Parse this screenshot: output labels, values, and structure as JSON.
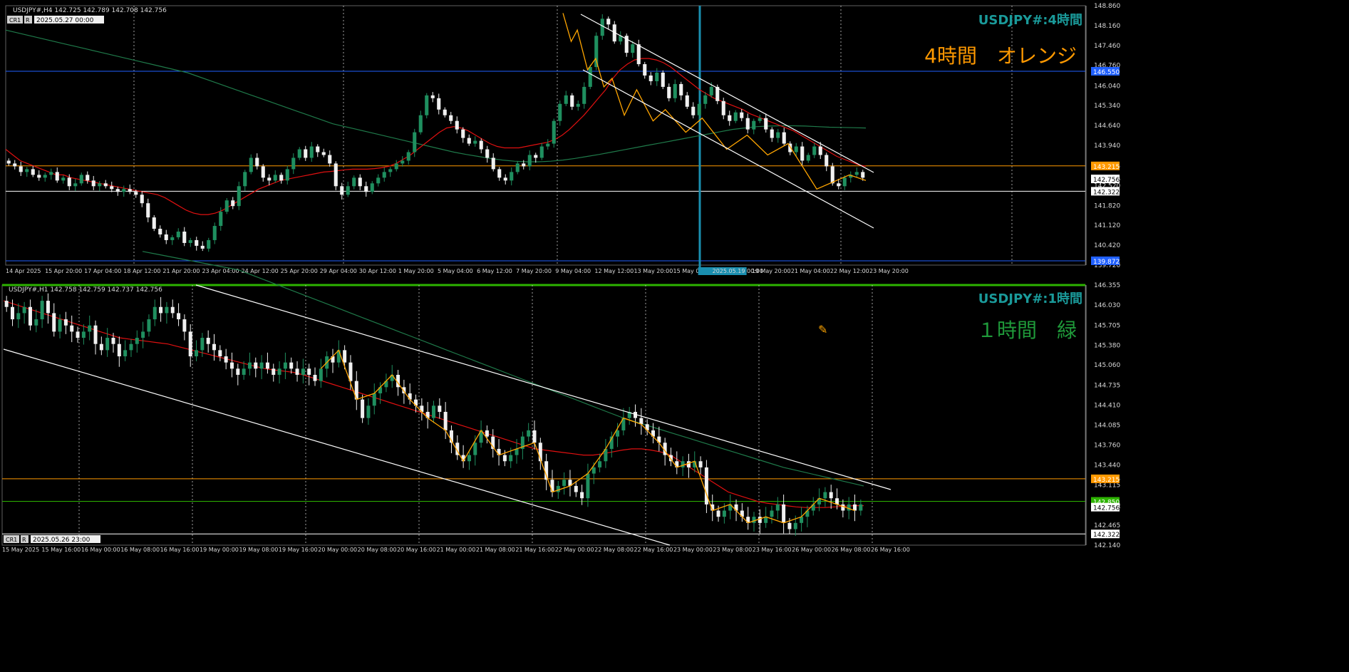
{
  "colors": {
    "background": "#000000",
    "grid": "#c8c8c8",
    "bull_candle": "#1f8f5f",
    "bear_candle": "#f0f0f0",
    "ma_red": "#e01010",
    "ma_green": "#1f7a4a",
    "zigzag": "#ffa500",
    "channel": "#ffffff",
    "level_orange": "#ff9900",
    "level_blue": "#2060ff",
    "level_white": "#ffffff",
    "level_green": "#2db300",
    "vline_cyan": "#1a8fb0",
    "title_teal": "#1a9a9a",
    "note_orange": "#ff9900",
    "note_green": "#1f9a3a",
    "axis_text": "#d8d8d8"
  },
  "chart_data": [
    {
      "type": "candlestick",
      "symbol_header": "USDJPY#,H4  142.725 142.789 142.708 142.756",
      "crosshair_box": {
        "btn1": "CR1",
        "btn2": "R",
        "datetime": "2025.05.27 00:00"
      },
      "title": "USDJPY#:4時間",
      "note": "4時間　オレンジ",
      "ylim": [
        139.72,
        148.86
      ],
      "y_ticks": [
        "148.860",
        "148.160",
        "147.460",
        "146.760",
        "146.040",
        "145.340",
        "144.640",
        "143.940",
        "143.215",
        "142.756",
        "142.520",
        "142.322",
        "141.820",
        "141.120",
        "140.420",
        "139.872",
        "139.720"
      ],
      "x_ticks": [
        "14 Apr 2025",
        "15 Apr 20:00",
        "17 Apr 04:00",
        "18 Apr 12:00",
        "21 Apr 20:00",
        "23 Apr 04:00",
        "24 Apr 12:00",
        "25 Apr 20:00",
        "29 Apr 04:00",
        "30 Apr 12:00",
        "1 May 20:00",
        "5 May 04:00",
        "6 May 12:00",
        "7 May 20:00",
        "9 May 04:00",
        "12 May 12:00",
        "13 May 20:00",
        "15 May 04:00",
        "2025.05.19 00:00",
        "19 May 20:00",
        "21 May 04:00",
        "22 May 12:00",
        "23 May 20:00"
      ],
      "price_labels": [
        {
          "value": 146.55,
          "text": "146.550",
          "color": "level_blue"
        },
        {
          "value": 143.215,
          "text": "143.215",
          "color": "level_orange"
        },
        {
          "value": 142.756,
          "text": "142.756",
          "color": "level_white"
        },
        {
          "value": 142.322,
          "text": "142.322",
          "color": "level_white"
        },
        {
          "value": 139.872,
          "text": "139.872",
          "color": "level_blue"
        }
      ],
      "closes": [
        143.3,
        143.2,
        143.0,
        143.1,
        142.9,
        142.8,
        142.9,
        143.0,
        142.7,
        142.8,
        142.5,
        142.6,
        142.9,
        142.7,
        142.5,
        142.6,
        142.5,
        142.4,
        142.3,
        142.4,
        142.3,
        142.2,
        141.9,
        141.4,
        141.0,
        140.8,
        140.6,
        140.7,
        140.9,
        140.5,
        140.6,
        140.4,
        140.3,
        140.6,
        141.1,
        141.6,
        142.0,
        141.8,
        142.5,
        143.0,
        143.5,
        143.2,
        142.8,
        142.7,
        142.9,
        142.7,
        143.1,
        143.5,
        143.8,
        143.5,
        143.9,
        143.7,
        143.6,
        143.3,
        142.5,
        142.2,
        142.5,
        142.8,
        142.5,
        142.3,
        142.6,
        142.8,
        143.0,
        143.1,
        143.3,
        143.4,
        143.7,
        144.4,
        145.0,
        145.7,
        145.6,
        145.2,
        145.0,
        144.8,
        144.5,
        144.2,
        144.0,
        144.1,
        143.8,
        143.5,
        143.1,
        142.8,
        142.7,
        143.0,
        143.3,
        143.2,
        143.6,
        143.5,
        143.9,
        144.0,
        144.8,
        145.4,
        145.7,
        145.3,
        145.4,
        146.0,
        146.7,
        147.8,
        148.4,
        148.2,
        147.6,
        147.8,
        147.2,
        147.5,
        146.8,
        146.4,
        146.2,
        146.5,
        146.0,
        145.6,
        146.1,
        145.7,
        145.3,
        145.0,
        145.4,
        145.7,
        146.0,
        145.5,
        145.0,
        144.8,
        145.1,
        144.9,
        144.5,
        144.8,
        144.9,
        144.5,
        144.2,
        144.4,
        144.0,
        143.7,
        143.9,
        143.4,
        143.6,
        143.9,
        143.6,
        143.2,
        142.6,
        142.5,
        142.8,
        142.9,
        143.0,
        142.8
      ],
      "ma_red": [
        143.8,
        143.6,
        143.4,
        143.3,
        143.2,
        143.1,
        143.0,
        142.9,
        142.9,
        142.8,
        142.75,
        142.7,
        142.65,
        142.6,
        142.55,
        142.5,
        142.45,
        142.4,
        142.35,
        142.3,
        142.25,
        142.2,
        142.1,
        141.95,
        141.8,
        141.65,
        141.55,
        141.5,
        141.5,
        141.55,
        141.65,
        141.8,
        141.95,
        142.1,
        142.25,
        142.4,
        142.5,
        142.6,
        142.7,
        142.75,
        142.8,
        142.85,
        142.9,
        142.95,
        143.0,
        143.02,
        143.05,
        143.08,
        143.1,
        143.1,
        143.1,
        143.12,
        143.15,
        143.2,
        143.3,
        143.45,
        143.6,
        143.8,
        144.0,
        144.2,
        144.4,
        144.55,
        144.6,
        144.55,
        144.45,
        144.3,
        144.15,
        144.0,
        143.9,
        143.85,
        143.85,
        143.85,
        143.9,
        143.95,
        144.0,
        144.05,
        144.15,
        144.3,
        144.5,
        144.75,
        145.0,
        145.3,
        145.6,
        145.9,
        146.3,
        146.6,
        146.8,
        146.95,
        147.0,
        147.0,
        146.95,
        146.85,
        146.7,
        146.5,
        146.3,
        146.1,
        145.9,
        145.75,
        145.6,
        145.5,
        145.4,
        145.3,
        145.2,
        145.05,
        144.95,
        144.85,
        144.75,
        144.65,
        144.55,
        144.45,
        144.3,
        144.15,
        144.0,
        143.85,
        143.7,
        143.55,
        143.45,
        143.35,
        143.25,
        143.2
      ],
      "ma_green": [
        148.0,
        147.9,
        147.8,
        147.7,
        147.6,
        147.5,
        147.4,
        147.3,
        147.2,
        147.1,
        147.0,
        146.9,
        146.8,
        146.7,
        146.6,
        146.5,
        146.35,
        146.2,
        146.05,
        145.9,
        145.75,
        145.6,
        145.45,
        145.3,
        145.15,
        145.0,
        144.85,
        144.7,
        144.6,
        144.5,
        144.4,
        144.3,
        144.2,
        144.1,
        144.0,
        143.9,
        143.8,
        143.7,
        143.62,
        143.55,
        143.48,
        143.42,
        143.38,
        143.36,
        143.36,
        143.38,
        143.42,
        143.48,
        143.55,
        143.62,
        143.7,
        143.78,
        143.86,
        143.94,
        144.02,
        144.1,
        144.18,
        144.26,
        144.34,
        144.42,
        144.5,
        144.55,
        144.6,
        144.62,
        144.63,
        144.63,
        144.62,
        144.6,
        144.58,
        144.57,
        144.56,
        144.55
      ],
      "zigzag": [
        [
          148.6,
          0
        ],
        [
          147.6,
          0.02
        ],
        [
          148.0,
          0.035
        ],
        [
          146.6,
          0.06
        ],
        [
          147.0,
          0.08
        ],
        [
          146.0,
          0.1
        ],
        [
          146.3,
          0.12
        ],
        [
          145.0,
          0.15
        ],
        [
          145.9,
          0.18
        ],
        [
          144.8,
          0.22
        ],
        [
          145.2,
          0.25
        ],
        [
          144.4,
          0.3
        ],
        [
          144.9,
          0.34
        ],
        [
          143.8,
          0.4
        ],
        [
          144.3,
          0.45
        ],
        [
          143.6,
          0.5
        ],
        [
          144.0,
          0.55
        ],
        [
          142.4,
          0.62
        ],
        [
          142.9,
          0.7
        ],
        [
          142.7,
          0.74
        ]
      ]
    },
    {
      "type": "candlestick",
      "symbol_header": "USDJPY#,H1  142.758 142.759 142.737 142.756",
      "crosshair_box": {
        "btn1": "CR1",
        "btn2": "R",
        "datetime": "2025.05.26 23:00"
      },
      "title": "USDJPY#:1時間",
      "note": "１時間　緑",
      "ylim": [
        142.14,
        146.355
      ],
      "y_ticks": [
        "146.355",
        "146.030",
        "145.705",
        "145.380",
        "145.060",
        "144.735",
        "144.410",
        "144.085",
        "143.760",
        "143.440",
        "143.215",
        "143.115",
        "142.790",
        "142.756",
        "142.465",
        "142.322",
        "142.140"
      ],
      "x_ticks": [
        "15 May 2025",
        "15 May 16:00",
        "16 May 00:00",
        "16 May 08:00",
        "16 May 16:00",
        "19 May 00:00",
        "19 May 08:00",
        "19 May 16:00",
        "20 May 00:00",
        "20 May 08:00",
        "20 May 16:00",
        "21 May 00:00",
        "21 May 08:00",
        "21 May 16:00",
        "22 May 00:00",
        "22 May 08:00",
        "22 May 16:00",
        "23 May 00:00",
        "23 May 08:00",
        "23 May 16:00",
        "26 May 00:00",
        "26 May 08:00",
        "26 May 16:00"
      ],
      "price_labels": [
        {
          "value": 143.215,
          "text": "143.215",
          "color": "level_orange"
        },
        {
          "value": 142.85,
          "text": "142.850",
          "color": "level_green"
        },
        {
          "value": 142.756,
          "text": "142.756",
          "color": "level_white"
        },
        {
          "value": 142.322,
          "text": "142.322",
          "color": "level_white"
        }
      ],
      "closes": [
        146.0,
        145.8,
        145.9,
        146.0,
        145.7,
        145.8,
        146.1,
        145.9,
        145.6,
        145.8,
        145.7,
        145.6,
        145.5,
        145.6,
        145.7,
        145.4,
        145.3,
        145.5,
        145.4,
        145.2,
        145.3,
        145.4,
        145.5,
        145.6,
        145.8,
        146.0,
        145.9,
        146.0,
        145.9,
        145.8,
        145.6,
        145.2,
        145.3,
        145.5,
        145.4,
        145.3,
        145.2,
        145.1,
        145.0,
        144.9,
        145.0,
        145.1,
        145.0,
        145.1,
        145.0,
        144.9,
        145.0,
        145.1,
        145.0,
        144.9,
        145.0,
        144.9,
        144.8,
        145.0,
        145.2,
        145.1,
        145.3,
        145.1,
        144.8,
        144.5,
        144.2,
        144.4,
        144.6,
        144.7,
        144.8,
        144.9,
        144.7,
        144.6,
        144.5,
        144.4,
        144.3,
        144.2,
        144.4,
        144.3,
        144.0,
        143.8,
        143.6,
        143.5,
        143.6,
        143.8,
        144.0,
        143.9,
        143.7,
        143.6,
        143.5,
        143.6,
        143.7,
        143.9,
        144.0,
        143.8,
        143.5,
        143.2,
        143.0,
        143.1,
        143.2,
        143.1,
        143.0,
        142.9,
        143.3,
        143.4,
        143.5,
        143.7,
        143.9,
        144.0,
        144.2,
        144.3,
        144.2,
        144.1,
        144.0,
        143.9,
        143.8,
        143.6,
        143.5,
        143.4,
        143.5,
        143.4,
        143.5,
        143.4,
        142.8,
        142.7,
        142.6,
        142.7,
        142.8,
        142.7,
        142.6,
        142.5,
        142.6,
        142.5,
        142.6,
        142.7,
        142.8,
        142.5,
        142.4,
        142.5,
        142.6,
        142.7,
        142.8,
        142.9,
        143.0,
        142.9,
        142.8,
        142.7,
        142.8,
        142.7,
        142.8
      ],
      "ma_red": [
        146.1,
        146.05,
        146.0,
        145.95,
        145.9,
        145.85,
        145.8,
        145.75,
        145.7,
        145.65,
        145.6,
        145.55,
        145.5,
        145.48,
        145.46,
        145.44,
        145.42,
        145.4,
        145.36,
        145.32,
        145.28,
        145.24,
        145.2,
        145.16,
        145.12,
        145.08,
        145.04,
        145.0,
        144.98,
        144.96,
        144.94,
        144.9,
        144.85,
        144.8,
        144.75,
        144.7,
        144.65,
        144.6,
        144.55,
        144.5,
        144.45,
        144.4,
        144.35,
        144.3,
        144.25,
        144.2,
        144.15,
        144.1,
        144.05,
        144.0,
        143.95,
        143.9,
        143.85,
        143.8,
        143.75,
        143.7,
        143.68,
        143.66,
        143.64,
        143.62,
        143.6,
        143.6,
        143.62,
        143.65,
        143.68,
        143.7,
        143.7,
        143.68,
        143.65,
        143.6,
        143.5,
        143.4,
        143.3,
        143.2,
        143.1,
        143.0,
        142.95,
        142.9,
        142.85,
        142.82,
        142.8,
        142.78,
        142.76,
        142.75,
        142.75,
        142.75,
        142.76,
        142.77,
        142.78,
        142.78
      ],
      "ma_green": [
        146.9,
        146.85,
        146.8,
        146.75,
        146.7,
        146.65,
        146.6,
        146.5,
        146.4,
        146.3,
        146.2,
        146.1,
        146.0,
        145.9,
        145.8,
        145.7,
        145.6,
        145.5,
        145.4,
        145.3,
        145.2,
        145.1,
        145.0,
        144.9,
        144.8,
        144.7,
        144.6,
        144.5,
        144.4,
        144.3,
        144.2,
        144.12,
        144.04,
        143.96,
        143.88,
        143.8,
        143.72,
        143.64,
        143.56,
        143.48,
        143.4,
        143.34,
        143.28,
        143.22,
        143.16,
        143.1
      ]
    }
  ]
}
